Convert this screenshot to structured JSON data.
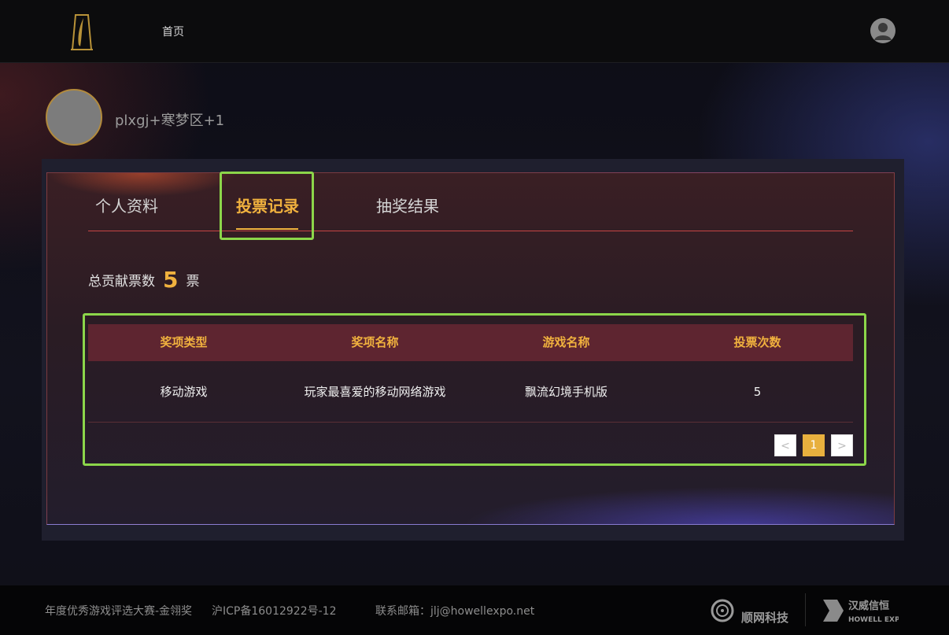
{
  "header": {
    "nav_home": "首页"
  },
  "user": {
    "name": "plxgj+寒梦区+1"
  },
  "tabs": [
    {
      "label": "个人资料",
      "active": false
    },
    {
      "label": "投票记录",
      "active": true
    },
    {
      "label": "抽奖结果",
      "active": false
    }
  ],
  "summary": {
    "prefix": "总贡献票数",
    "count": "5",
    "suffix": "票"
  },
  "table": {
    "headers": [
      "奖项类型",
      "奖项名称",
      "游戏名称",
      "投票次数"
    ],
    "rows": [
      [
        "移动游戏",
        "玩家最喜爱的移动网络游戏",
        "飘流幻境手机版",
        "5"
      ]
    ]
  },
  "pagination": {
    "prev": "<",
    "current": "1",
    "next": ">"
  },
  "footer": {
    "site_name": "年度优秀游戏评选大赛-金翎奖",
    "icp": "沪ICP备16012922号-12",
    "contact": "联系邮箱：jlj@howellexpo.net",
    "sponsor1_name": "顺网科技",
    "sponsor2_name": "汉威信恒",
    "sponsor2_en": "HOWELL EXPO"
  },
  "colors": {
    "accent": "#f0b13e",
    "highlight": "#8cd64a",
    "table_header_bg": "#5e2530"
  }
}
